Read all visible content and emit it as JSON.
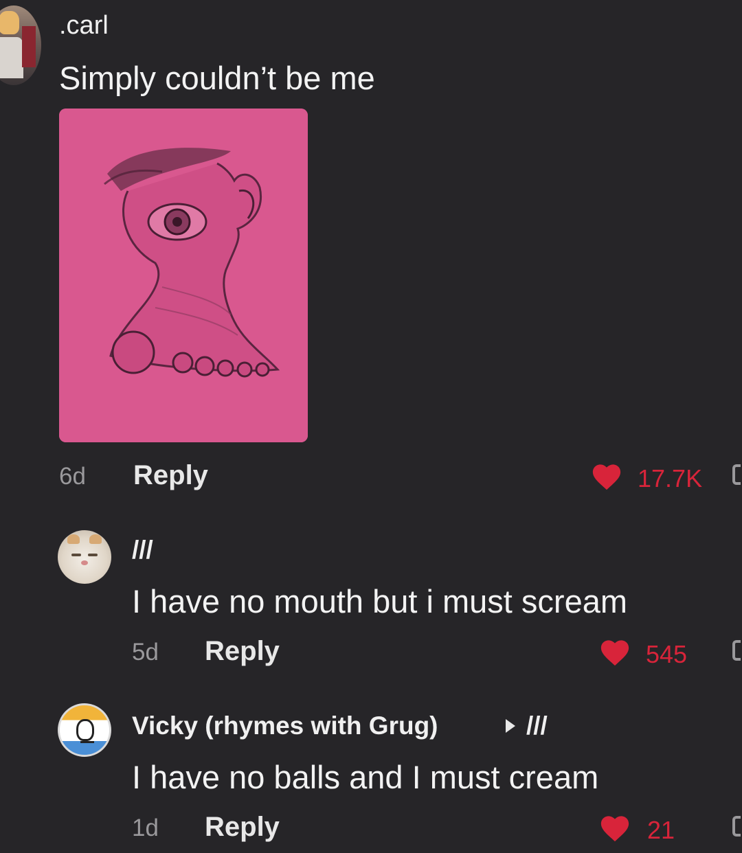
{
  "comments": [
    {
      "username": ".carl",
      "text": "Simply couldn’t be me",
      "time": "6d",
      "reply_label": "Reply",
      "likes": "17.7K",
      "avatar_icon": "anime-character-avatar-icon",
      "has_image": true
    },
    {
      "username": "///",
      "text": "I have no mouth but i must scream",
      "time": "5d",
      "reply_label": "Reply",
      "likes": "545",
      "avatar_icon": "cat-avatar-icon"
    },
    {
      "username": "Vicky (rhymes with Grug)",
      "reply_to": "///",
      "text": "I have no balls and I must cream",
      "time": "1d",
      "reply_label": "Reply",
      "likes": "21",
      "avatar_icon": "cartoon-avatar-icon"
    }
  ],
  "colors": {
    "background": "#262528",
    "like_red": "#d8243a",
    "muted_text": "#9a999c",
    "drawing_pink": "#d9588f"
  }
}
